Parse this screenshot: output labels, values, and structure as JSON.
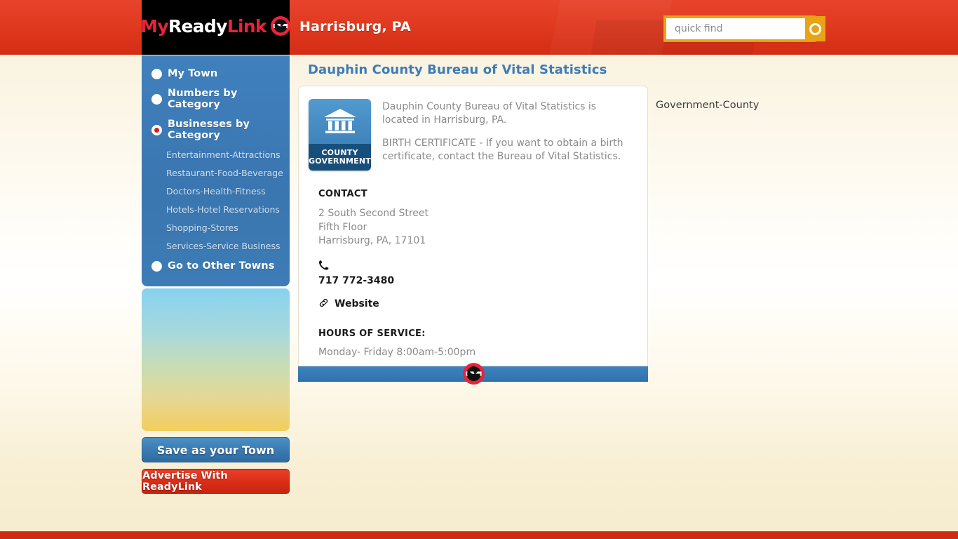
{
  "header": {
    "logo": {
      "part1": "My",
      "part2": "Ready",
      "part3": "Link",
      "mark": "readylink-circle-icon"
    },
    "town": "Harrisburg, PA",
    "search": {
      "placeholder": "quick find",
      "value": "",
      "button_icon": "search-circle-icon"
    }
  },
  "sidebar": {
    "nav": [
      {
        "label": "My Town",
        "active": false
      },
      {
        "label": "Numbers by Category",
        "active": false
      },
      {
        "label": "Businesses by Category",
        "active": true
      }
    ],
    "subnav": [
      {
        "label": "Entertainment-Attractions"
      },
      {
        "label": "Restaurant-Food-Beverage"
      },
      {
        "label": "Doctors-Health-Fitness"
      },
      {
        "label": "Hotels-Hotel Reservations"
      },
      {
        "label": "Shopping-Stores"
      },
      {
        "label": "Services-Service Business"
      }
    ],
    "nav_last": {
      "label": "Go to Other Towns",
      "active": false
    },
    "buttons": {
      "save": "Save as your Town",
      "advertise": "Advertise With ReadyLink"
    }
  },
  "main": {
    "title": "Dauphin County Bureau of Vital Statistics",
    "badge": {
      "icon": "government-building-icon",
      "line1": "COUNTY",
      "line2": "GOVERNMENT"
    },
    "description_1": "Dauphin County Bureau of Vital Statistics is located in Harrisburg, PA.",
    "description_2": "BIRTH CERTIFICATE - If you want to obtain a birth certificate, contact the Bureau of Vital Statistics.",
    "contact_heading": "CONTACT",
    "address_line1": "2 South Second Street",
    "address_line2": "Fifth Floor",
    "address_line3": "Harrisburg, PA, 17101",
    "phone": "717 772-3480",
    "website_label": "Website",
    "hours_heading": "HOURS OF SERVICE:",
    "hours_value": "Monday- Friday 8:00am-5:00pm",
    "footer_logo": "readylink-circle-icon"
  },
  "category_tag": "Government-County",
  "colors": {
    "header_red": "#e03a20",
    "brand_red": "#d81f17",
    "sidebar_blue": "#3d7cb6",
    "title_blue": "#3d7cb8",
    "gold": "#e8a317",
    "cream": "#f6ecce"
  }
}
